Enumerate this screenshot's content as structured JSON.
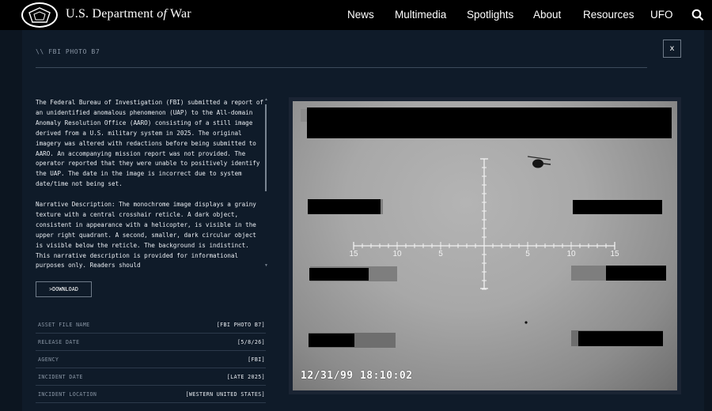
{
  "header": {
    "brand_prefix": "U.S. Department ",
    "brand_of": "of",
    "brand_suffix": " War",
    "nav": [
      "News",
      "Multimedia",
      "Spotlights",
      "About",
      "Resources",
      "UFO"
    ]
  },
  "panel": {
    "kicker": "\\\\  FBI PHOTO B7",
    "close_label": "x",
    "description_1": "The Federal Bureau of Investigation (FBI) submitted a report of an unidentified anomalous phenomenon (UAP) to the All-domain Anomaly Resolution Office (AARO) consisting of a still image derived from a U.S. military system in 2025. The original imagery was altered with redactions before being submitted to AARO. An accompanying mission report was not provided. The operator reported that they were unable to positively identify the UAP. The date in the image is incorrect due to system date/time not being set.",
    "description_2": "Narrative Description: The monochrome image displays a grainy texture with a central crosshair reticle. A dark object, consistent in appearance with a helicopter, is visible in the upper right quadrant. A second, smaller, dark circular object is visible below the reticle. The background is indistinct. This narrative description is provided for informational purposes only. Readers should",
    "download_label": ">DOWNLOAD",
    "metadata": [
      {
        "key": "ASSET FILE NAME",
        "value": "[FBI PHOTO B7]"
      },
      {
        "key": "RELEASE DATE",
        "value": "[5/8/26]"
      },
      {
        "key": "AGENCY",
        "value": "[FBI]"
      },
      {
        "key": "INCIDENT DATE",
        "value": "[LATE 2025]"
      },
      {
        "key": "INCIDENT LOCATION",
        "value": "[WESTERN UNITED STATES]"
      }
    ]
  },
  "image": {
    "timestamp": "12/31/99 18:10:02",
    "scale_labels": [
      "15",
      "10",
      "5",
      "5",
      "10",
      "15"
    ]
  }
}
